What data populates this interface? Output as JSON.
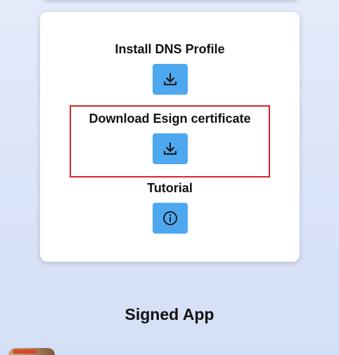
{
  "card": {
    "install_dns_title": "Install DNS Profile",
    "download_cert_title": "Download Esign certificate",
    "tutorial_title": "Tutorial",
    "install_dns_icon": "download-icon",
    "download_cert_icon": "download-icon",
    "tutorial_icon": "info-icon",
    "button_color": "#4ea8f0",
    "highlight_color": "#d9262e"
  },
  "signed_app": {
    "title": "Signed App"
  }
}
